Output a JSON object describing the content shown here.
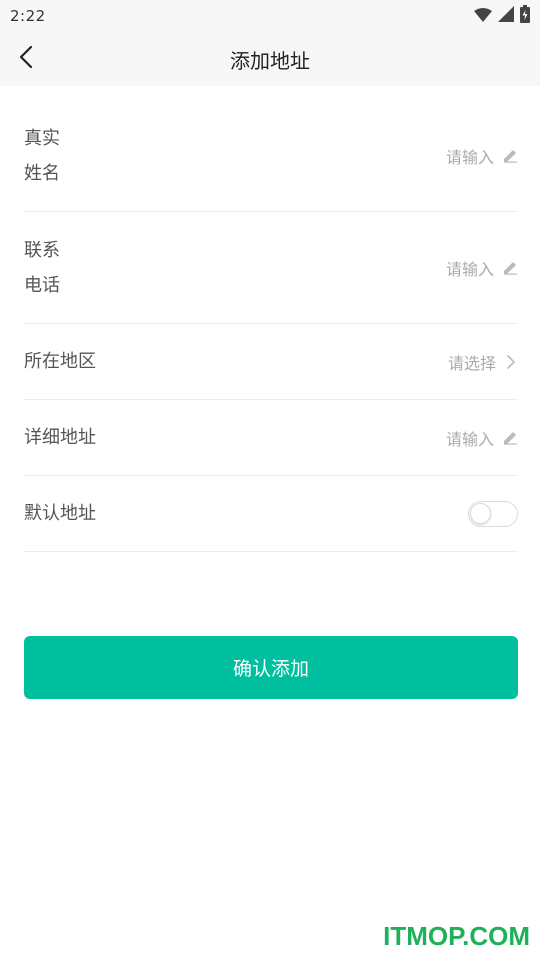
{
  "status_bar": {
    "time": "2:22",
    "icons": [
      "wifi-icon",
      "signal-icon",
      "battery-icon"
    ]
  },
  "header": {
    "title": "添加地址",
    "back_icon": "chevron-left-icon"
  },
  "form": {
    "fields": [
      {
        "label": "真实姓名",
        "hint": "请输入",
        "action_icon": "pencil-icon"
      },
      {
        "label": "联系电话",
        "hint": "请输入",
        "action_icon": "pencil-icon"
      },
      {
        "label": "所在地区",
        "hint": "请选择",
        "action_icon": "chevron-right-icon"
      },
      {
        "label": "详细地址",
        "hint": "请输入",
        "action_icon": "pencil-icon"
      },
      {
        "label": "默认地址",
        "toggle_on": false
      }
    ]
  },
  "submit": {
    "label": "确认添加"
  },
  "watermark": {
    "text": "ITMOP.COM"
  },
  "colors": {
    "accent": "#00bf9f",
    "header_bg": "#f7f7f7",
    "hint": "#aaaaaa",
    "watermark": "#1fb15a"
  }
}
